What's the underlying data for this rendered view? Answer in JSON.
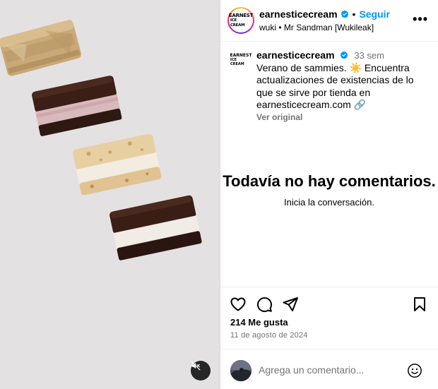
{
  "header": {
    "username": "earnesticecream",
    "separator": "•",
    "follow_label": "Seguir",
    "subtitle": "wuki • Mr Sandman [Wukileak]",
    "more_label": "•••",
    "logo_line1": "EARNEST",
    "logo_line2": "ICE CREAM"
  },
  "caption": {
    "username": "earnesticecream",
    "time": "33 sem",
    "text": "Verano de sammies. ☀️ Encuentra actualizaciones de existencias de lo que se sirve por tienda en earnesticecream.com 🔗",
    "translate_label": "Ver original"
  },
  "comments_empty": {
    "title": "Todavía no hay comentarios.",
    "subtitle": "Inicia la conversación."
  },
  "post": {
    "likes": "214 Me gusta",
    "date": "11 de agosto de 2024"
  },
  "comment_box": {
    "placeholder": "Agrega un comentario..."
  },
  "icons": {
    "like": "heart-icon",
    "comment": "comment-icon",
    "share": "send-icon",
    "save": "bookmark-icon",
    "mute": "speaker-muted-icon",
    "emoji": "emoji-icon",
    "verified": "verified-badge-icon"
  },
  "colors": {
    "follow": "#0095f6",
    "verified": "#0095f6",
    "secondary_text": "#737373",
    "media_background": "#e4e1e3"
  }
}
